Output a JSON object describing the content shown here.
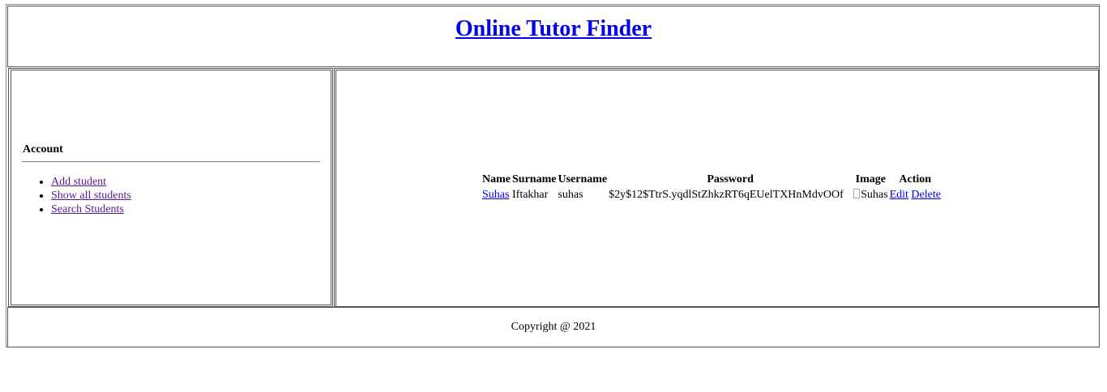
{
  "header": {
    "title": "Online Tutor Finder"
  },
  "sidebar": {
    "heading": "Account",
    "items": [
      {
        "label": "Add student"
      },
      {
        "label": "Show all students"
      },
      {
        "label": "Search Students"
      }
    ]
  },
  "table": {
    "columns": [
      "Name",
      "Surname",
      "Username",
      "Password",
      "Image",
      "Action"
    ],
    "rows": [
      {
        "name": "Suhas",
        "surname": "Iftakhar",
        "username": "suhas",
        "password": "$2y$12$TtrS.yqdlStZhkzRT6qEUelTXHnMdvOOf",
        "image_alt": "Suhas",
        "edit": "Edit",
        "delete": "Delete"
      }
    ]
  },
  "footer": {
    "text": "Copyright @ 2021"
  },
  "colors": {
    "link": "#0000ee",
    "visited_link": "#551a8b"
  }
}
